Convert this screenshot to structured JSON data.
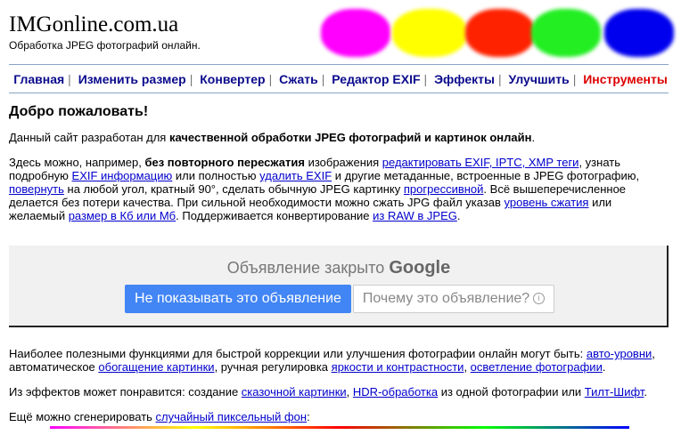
{
  "header": {
    "title": "IMGonline.com.ua",
    "subtitle": "Обработка JPEG фотографий онлайн."
  },
  "colors": {
    "accent_blue": "#4285f4",
    "nav_blue": "#0a0a8c",
    "nav_red": "#dd0000",
    "blob_colors": [
      "#ff00ff",
      "#ffff00",
      "#ff2200",
      "#22ee22",
      "#0000ee"
    ]
  },
  "nav": {
    "items": [
      {
        "label": "Главная"
      },
      {
        "label": "Изменить размер"
      },
      {
        "label": "Конвертер"
      },
      {
        "label": "Сжать"
      },
      {
        "label": "Редактор EXIF"
      },
      {
        "label": "Эффекты"
      },
      {
        "label": "Улучшить"
      },
      {
        "label": "Инструменты"
      }
    ],
    "separator": "|"
  },
  "welcome": {
    "heading": "Добро пожаловать!",
    "p1_start": "Данный сайт разработан для ",
    "p1_bold": "качественной обработки JPEG фотографий и картинок онлайн",
    "p1_end": ".",
    "p2_a": "Здесь можно, например, ",
    "p2_bold": "без повторного пересжатия",
    "p2_b": " изображения ",
    "link_edit_exif": "редактировать EXIF, IPTC, XMP теги",
    "p2_c": ", узнать подробную ",
    "link_exif_info": "EXIF информацию",
    "p2_d": " или полностью ",
    "link_delete_exif": "удалить EXIF",
    "p2_e": " и другие метаданные, встроенные в JPEG фотографию, ",
    "link_rotate": "повернуть",
    "p2_f": " на любой угол, кратный 90°, сделать обычную JPEG картинку ",
    "link_progressive": "прогрессивной",
    "p2_g": ". Всё вышеперечисленное делается без потери качества. При сильной необходимости можно сжать JPG файл указав ",
    "link_compress_level": "уровень сжатия",
    "p2_h": " или желаемый ",
    "link_size": "размер в Кб или Мб",
    "p2_i": ". Поддерживается конвертирование ",
    "link_raw": "из RAW в JPEG",
    "p2_j": "."
  },
  "ad": {
    "closed_text": "Объявление закрыто",
    "brand": "Google",
    "hide_button": "Не показывать это объявление",
    "why_button": "Почему это объявление?",
    "info_glyph": "i"
  },
  "lower": {
    "p3_a": "Наиболее полезными функциями для быстрой коррекции или улучшения фотографии онлайн могут быть: ",
    "link_auto_levels": "авто-уровни",
    "p3_b": ", автоматическое ",
    "link_enrich": "обогащение картинки",
    "p3_c": ", ручная регулировка ",
    "link_brightness": "яркости и контрастности",
    "p3_d": ", ",
    "link_lighten": "осветление фотографии",
    "p3_e": ".",
    "p4_a": "Из эффектов может понравится: создание ",
    "link_fairy": "сказочной картинки",
    "p4_b": ", ",
    "link_hdr": "HDR-обработка",
    "p4_c": " из одной фотографии или ",
    "link_tilt": "Тилт-Шифт",
    "p4_d": ".",
    "p5_a": "Ещё можно сгенерировать ",
    "link_random_bg": "случайный пиксельный фон",
    "p5_b": ":"
  }
}
